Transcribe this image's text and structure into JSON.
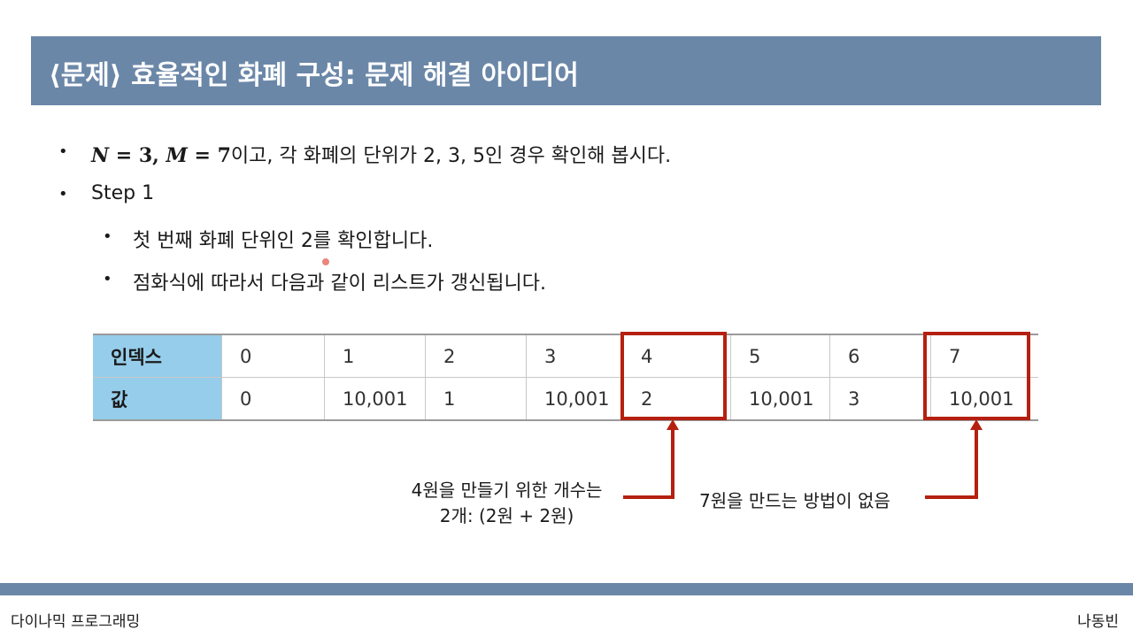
{
  "slide": {
    "title": "⟨문제⟩ 효율적인 화폐 구성: 문제 해결 아이디어"
  },
  "bullets": {
    "b1_n": "N",
    "b1_eq1": " = 3, ",
    "b1_m": "M",
    "b1_eq2": " = 7",
    "b1_rest": "이고, 각 화폐의 단위가 2, 3, 5인 경우 확인해 봅시다.",
    "b2": "Step 1",
    "b3": "첫 번째 화폐 단위인 2를 확인합니다.",
    "b4": "점화식에 따라서 다음과 같이 리스트가 갱신됩니다."
  },
  "table": {
    "index_header": "인덱스",
    "value_header": "값",
    "indices": [
      "0",
      "1",
      "2",
      "3",
      "4",
      "5",
      "6",
      "7"
    ],
    "values": [
      "0",
      "10,001",
      "1",
      "10,001",
      "2",
      "10,001",
      "3",
      "10,001"
    ]
  },
  "notes": {
    "left_line1": "4원을 만들기 위한 개수는",
    "left_line2": "2개: (2원 + 2원)",
    "right": "7원을 만드는 방법이 없음"
  },
  "footer": {
    "left": "다이나믹 프로그래밍",
    "right": "나동빈"
  },
  "colors": {
    "title_bar": "#6b87a8",
    "header_cell": "#96cdea",
    "highlight": "#b52010"
  }
}
